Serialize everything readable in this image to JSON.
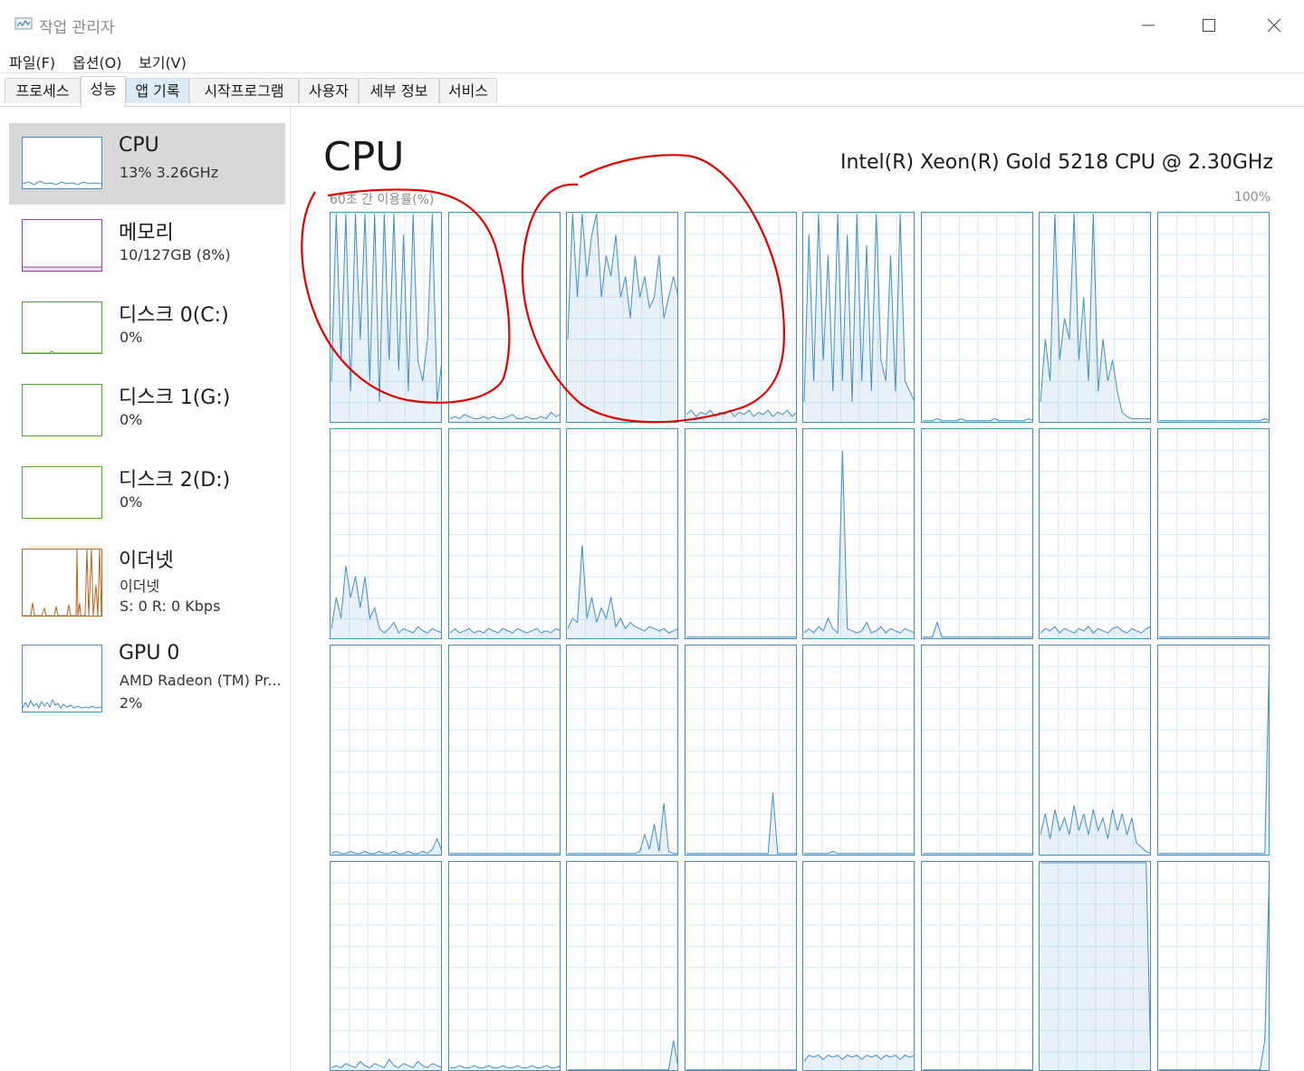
{
  "window": {
    "title": "작업 관리자"
  },
  "menu": [
    {
      "label": "파일(F)"
    },
    {
      "label": "옵션(O)"
    },
    {
      "label": "보기(V)"
    }
  ],
  "tabs": [
    {
      "label": "프로세스"
    },
    {
      "label": "성능"
    },
    {
      "label": "앱 기록"
    },
    {
      "label": "시작프로그램"
    },
    {
      "label": "사용자"
    },
    {
      "label": "세부 정보"
    },
    {
      "label": "서비스"
    }
  ],
  "active_tab": "성능",
  "sidebar": {
    "items": [
      {
        "name": "CPU",
        "line1": "13%  3.26GHz",
        "color": "#3f8fc1"
      },
      {
        "name": "메모리",
        "line1": "10/127GB (8%)",
        "color": "#9b3fa5"
      },
      {
        "name": "디스크 0(C:)",
        "line1": "0%",
        "color": "#4ea52d"
      },
      {
        "name": "디스크 1(G:)",
        "line1": "0%",
        "color": "#4ea52d"
      },
      {
        "name": "디스크 2(D:)",
        "line1": "0%",
        "color": "#4ea52d"
      },
      {
        "name": "이더넷",
        "line1": "이더넷",
        "line2": "S: 0  R: 0 Kbps",
        "color": "#b8631c"
      },
      {
        "name": "GPU 0",
        "line1": "AMD Radeon (TM) Pr...",
        "line2": "2%",
        "color": "#3f8fc1"
      }
    ]
  },
  "main": {
    "title": "CPU",
    "cpu_model": "Intel(R) Xeon(R) Gold 5218 CPU @ 2.30GHz",
    "util_label": "60초 간 이용률(%)",
    "util_max": "100%",
    "graph_color": "#3f8fc1",
    "grid_color": "#d9eaf5",
    "annotation_color": "#e00000"
  },
  "chart_data": {
    "type": "area",
    "title": "60초 간 이용률(%)",
    "ylim": [
      0,
      100
    ],
    "xlabel": "",
    "ylabel": "",
    "x_span_seconds": 60,
    "grid": true,
    "series": [
      {
        "values": [
          20,
          100,
          30,
          100,
          15,
          100,
          40,
          100,
          20,
          100,
          10,
          100,
          30,
          100,
          25,
          90,
          15,
          100,
          30,
          20,
          40,
          100,
          10,
          30
        ]
      },
      {
        "values": [
          2,
          3,
          2,
          4,
          3,
          2,
          2,
          3,
          2,
          3,
          2,
          2,
          3,
          4,
          2,
          2,
          3,
          2,
          2,
          3,
          2,
          5,
          3,
          4
        ]
      },
      {
        "values": [
          40,
          100,
          60,
          100,
          70,
          90,
          100,
          60,
          80,
          70,
          90,
          60,
          70,
          50,
          80,
          60,
          70,
          55,
          60,
          80,
          50,
          60,
          70,
          60
        ]
      },
      {
        "values": [
          4,
          6,
          3,
          5,
          4,
          6,
          3,
          5,
          4,
          6,
          3,
          5,
          4,
          6,
          3,
          5,
          4,
          6,
          3,
          5,
          4,
          6,
          3,
          5
        ]
      },
      {
        "values": [
          10,
          90,
          20,
          100,
          30,
          80,
          15,
          100,
          20,
          90,
          10,
          100,
          20,
          85,
          15,
          100,
          30,
          20,
          80,
          15,
          100,
          20,
          15,
          10
        ]
      },
      {
        "values": [
          1,
          1,
          1,
          2,
          1,
          1,
          1,
          1,
          2,
          1,
          1,
          1,
          1,
          1,
          1,
          2,
          1,
          1,
          1,
          1,
          1,
          1,
          2,
          1
        ]
      },
      {
        "values": [
          10,
          40,
          20,
          100,
          30,
          50,
          40,
          100,
          30,
          60,
          20,
          100,
          15,
          40,
          20,
          30,
          15,
          5,
          3,
          2,
          2,
          2,
          2,
          2
        ]
      },
      {
        "values": [
          1,
          1,
          1,
          1,
          1,
          1,
          1,
          1,
          1,
          1,
          1,
          1,
          1,
          1,
          1,
          1,
          1,
          1,
          1,
          1,
          1,
          1,
          2,
          1
        ]
      },
      {
        "values": [
          5,
          20,
          10,
          35,
          20,
          30,
          15,
          30,
          10,
          15,
          5,
          3,
          5,
          8,
          3,
          5,
          4,
          3,
          6,
          4,
          3,
          5,
          4,
          3
        ]
      },
      {
        "values": [
          3,
          5,
          3,
          4,
          5,
          3,
          4,
          3,
          5,
          4,
          3,
          5,
          4,
          3,
          5,
          4,
          3,
          4,
          5,
          3,
          4,
          3,
          5,
          4
        ]
      },
      {
        "values": [
          5,
          10,
          8,
          45,
          10,
          20,
          8,
          15,
          10,
          20,
          6,
          10,
          5,
          8,
          6,
          5,
          4,
          6,
          5,
          4,
          5,
          3,
          4,
          5
        ]
      },
      {
        "values": [
          1,
          1,
          1,
          1,
          1,
          1,
          1,
          1,
          1,
          1,
          1,
          1,
          1,
          1,
          1,
          1,
          1,
          1,
          1,
          1,
          1,
          1,
          1,
          1
        ]
      },
      {
        "values": [
          3,
          5,
          3,
          6,
          4,
          10,
          5,
          3,
          90,
          5,
          4,
          3,
          4,
          8,
          3,
          4,
          6,
          3,
          5,
          4,
          3,
          5,
          4,
          3
        ]
      },
      {
        "values": [
          1,
          1,
          1,
          8,
          1,
          1,
          1,
          1,
          1,
          1,
          1,
          1,
          1,
          1,
          1,
          1,
          1,
          1,
          1,
          1,
          1,
          1,
          1,
          1
        ]
      },
      {
        "values": [
          3,
          5,
          4,
          6,
          3,
          5,
          4,
          3,
          5,
          4,
          6,
          3,
          5,
          4,
          3,
          5,
          6,
          4,
          3,
          5,
          4,
          3,
          5,
          6
        ]
      },
      {
        "values": [
          1,
          1,
          1,
          1,
          1,
          1,
          1,
          1,
          1,
          1,
          1,
          1,
          1,
          1,
          1,
          1,
          1,
          1,
          1,
          1,
          1,
          1,
          1,
          1
        ]
      },
      {
        "values": [
          1,
          2,
          1,
          1,
          2,
          1,
          1,
          2,
          1,
          1,
          2,
          1,
          1,
          2,
          1,
          1,
          2,
          1,
          1,
          2,
          1,
          3,
          8,
          2
        ]
      },
      {
        "values": [
          1,
          1,
          1,
          1,
          1,
          1,
          1,
          1,
          1,
          1,
          1,
          1,
          1,
          1,
          1,
          1,
          1,
          1,
          1,
          1,
          1,
          1,
          1,
          1
        ]
      },
      {
        "values": [
          1,
          1,
          1,
          1,
          1,
          1,
          1,
          1,
          1,
          1,
          1,
          1,
          1,
          1,
          1,
          2,
          10,
          3,
          15,
          2,
          25,
          2,
          1,
          1
        ]
      },
      {
        "values": [
          1,
          1,
          1,
          1,
          1,
          1,
          1,
          1,
          1,
          1,
          1,
          1,
          1,
          1,
          1,
          1,
          1,
          1,
          30,
          1,
          1,
          1,
          1,
          1
        ]
      },
      {
        "values": [
          1,
          1,
          1,
          1,
          1,
          1,
          2,
          1,
          1,
          1,
          1,
          1,
          1,
          1,
          1,
          1,
          1,
          1,
          1,
          1,
          1,
          1,
          1,
          1
        ]
      },
      {
        "values": [
          1,
          1,
          1,
          1,
          1,
          1,
          1,
          1,
          1,
          1,
          1,
          1,
          1,
          1,
          1,
          1,
          1,
          1,
          1,
          1,
          1,
          1,
          1,
          1
        ]
      },
      {
        "values": [
          10,
          20,
          8,
          22,
          12,
          18,
          10,
          24,
          12,
          20,
          10,
          22,
          12,
          18,
          8,
          22,
          12,
          20,
          10,
          18,
          6,
          4,
          2,
          1
        ]
      },
      {
        "values": [
          1,
          1,
          1,
          1,
          1,
          1,
          1,
          1,
          1,
          1,
          1,
          1,
          1,
          1,
          1,
          1,
          1,
          1,
          1,
          1,
          1,
          1,
          1,
          100
        ]
      },
      {
        "values": [
          2,
          3,
          2,
          4,
          3,
          2,
          5,
          3,
          2,
          4,
          3,
          2,
          6,
          3,
          2,
          4,
          3,
          2,
          5,
          3,
          2,
          4,
          3,
          2
        ]
      },
      {
        "values": [
          2,
          2,
          3,
          2,
          2,
          3,
          2,
          2,
          3,
          2,
          2,
          3,
          2,
          2,
          3,
          2,
          2,
          3,
          2,
          2,
          3,
          2,
          2,
          3
        ]
      },
      {
        "values": [
          1,
          1,
          1,
          1,
          1,
          1,
          1,
          1,
          1,
          1,
          1,
          1,
          1,
          1,
          1,
          1,
          1,
          1,
          1,
          1,
          1,
          1,
          15,
          2
        ]
      },
      {
        "values": [
          1,
          1,
          1,
          1,
          1,
          1,
          1,
          1,
          1,
          1,
          1,
          1,
          1,
          1,
          1,
          1,
          1,
          1,
          1,
          1,
          1,
          1,
          1,
          1
        ]
      },
      {
        "values": [
          5,
          8,
          7,
          8,
          6,
          8,
          7,
          8,
          6,
          8,
          7,
          8,
          6,
          8,
          7,
          8,
          6,
          8,
          7,
          8,
          6,
          8,
          7,
          8
        ]
      },
      {
        "values": [
          1,
          1,
          1,
          1,
          1,
          1,
          1,
          1,
          1,
          1,
          1,
          1,
          1,
          1,
          1,
          1,
          1,
          1,
          1,
          1,
          1,
          1,
          1,
          1
        ]
      },
      {
        "values": [
          100,
          100,
          100,
          100,
          100,
          100,
          100,
          100,
          100,
          100,
          100,
          100,
          100,
          100,
          100,
          100,
          100,
          100,
          100,
          100,
          100,
          100,
          100,
          0
        ]
      },
      {
        "values": [
          1,
          1,
          1,
          1,
          1,
          1,
          1,
          1,
          1,
          1,
          1,
          1,
          1,
          1,
          1,
          1,
          1,
          1,
          1,
          1,
          1,
          1,
          15,
          100
        ]
      }
    ]
  }
}
